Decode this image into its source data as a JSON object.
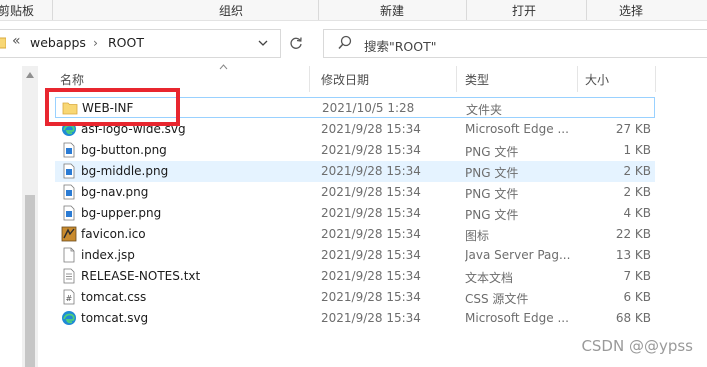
{
  "ribbon": {
    "groups": [
      "剪贴板",
      "组织",
      "新建",
      "打开",
      "选择"
    ]
  },
  "address": {
    "chevron": "«",
    "segments": [
      "webapps",
      "ROOT"
    ],
    "separator": "›"
  },
  "search": {
    "placeholder": "搜索\"ROOT\""
  },
  "columns": {
    "name": "名称",
    "date": "修改日期",
    "type": "类型",
    "size": "大小"
  },
  "files": [
    {
      "name": "WEB-INF",
      "date": "2021/10/5 1:28",
      "type": "文件夹",
      "size": "",
      "icon": "folder-icon"
    },
    {
      "name": "asf-logo-wide.svg",
      "date": "2021/9/28 15:34",
      "type": "Microsoft Edge ...",
      "size": "27 KB",
      "icon": "edge-icon"
    },
    {
      "name": "bg-button.png",
      "date": "2021/9/28 15:34",
      "type": "PNG 文件",
      "size": "1 KB",
      "icon": "image-file-icon"
    },
    {
      "name": "bg-middle.png",
      "date": "2021/9/28 15:34",
      "type": "PNG 文件",
      "size": "2 KB",
      "icon": "image-file-icon"
    },
    {
      "name": "bg-nav.png",
      "date": "2021/9/28 15:34",
      "type": "PNG 文件",
      "size": "2 KB",
      "icon": "image-file-icon"
    },
    {
      "name": "bg-upper.png",
      "date": "2021/9/28 15:34",
      "type": "PNG 文件",
      "size": "4 KB",
      "icon": "image-file-icon"
    },
    {
      "name": "favicon.ico",
      "date": "2021/9/28 15:34",
      "type": "图标",
      "size": "22 KB",
      "icon": "icon-file-icon"
    },
    {
      "name": "index.jsp",
      "date": "2021/9/28 15:34",
      "type": "Java Server Pag...",
      "size": "13 KB",
      "icon": "document-icon"
    },
    {
      "name": "RELEASE-NOTES.txt",
      "date": "2021/9/28 15:34",
      "type": "文本文档",
      "size": "7 KB",
      "icon": "text-file-icon"
    },
    {
      "name": "tomcat.css",
      "date": "2021/9/28 15:34",
      "type": "CSS 源文件",
      "size": "6 KB",
      "icon": "css-file-icon"
    },
    {
      "name": "tomcat.svg",
      "date": "2021/9/28 15:34",
      "type": "Microsoft Edge ...",
      "size": "68 KB",
      "icon": "edge-icon"
    }
  ],
  "watermark": "CSDN @@ypss",
  "colors": {
    "highlight": "#e8262f",
    "selection": "#e5f3ff",
    "folder": "#f8d775"
  }
}
